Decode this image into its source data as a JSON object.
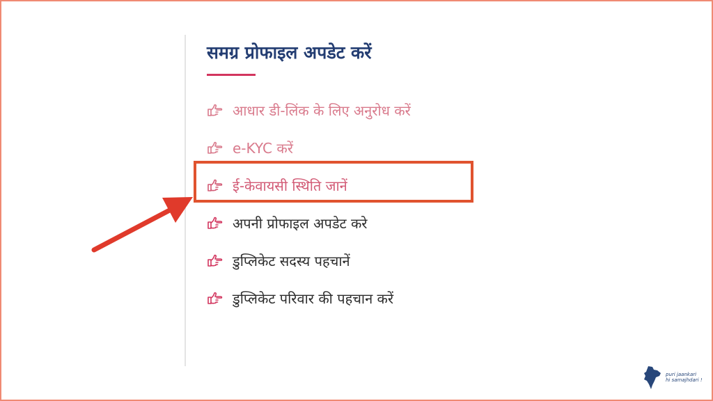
{
  "section": {
    "title": "समग्र प्रोफाइल अपडेट करें"
  },
  "menu_items": [
    {
      "label": "आधार डी-लिंक के लिए अनुरोध करें",
      "icon": "hand-point-right-icon"
    },
    {
      "label": "e-KYC करें",
      "icon": "hand-point-right-icon"
    },
    {
      "label": "ई-केवायसी स्थिति जानें",
      "icon": "hand-point-right-icon",
      "highlighted": true
    },
    {
      "label": "अपनी प्रोफाइल अपडेट करे",
      "icon": "hand-point-right-icon"
    },
    {
      "label": "डुप्लिकेट सदस्य पहचानें",
      "icon": "hand-point-right-icon"
    },
    {
      "label": "डुप्लिकेट परिवार की पहचान करें",
      "icon": "hand-point-right-icon"
    }
  ],
  "watermark": {
    "line1": "puri jaankari",
    "line2": "hi samajhdari !"
  },
  "colors": {
    "title": "#233d72",
    "underline": "#d2355e",
    "highlight_border": "#e0532f",
    "arrow": "#e03a2b",
    "link_light": "#d97a8c",
    "link_active": "#d25a75",
    "link_dark": "#2c2c2c",
    "frame": "#f08a73"
  }
}
